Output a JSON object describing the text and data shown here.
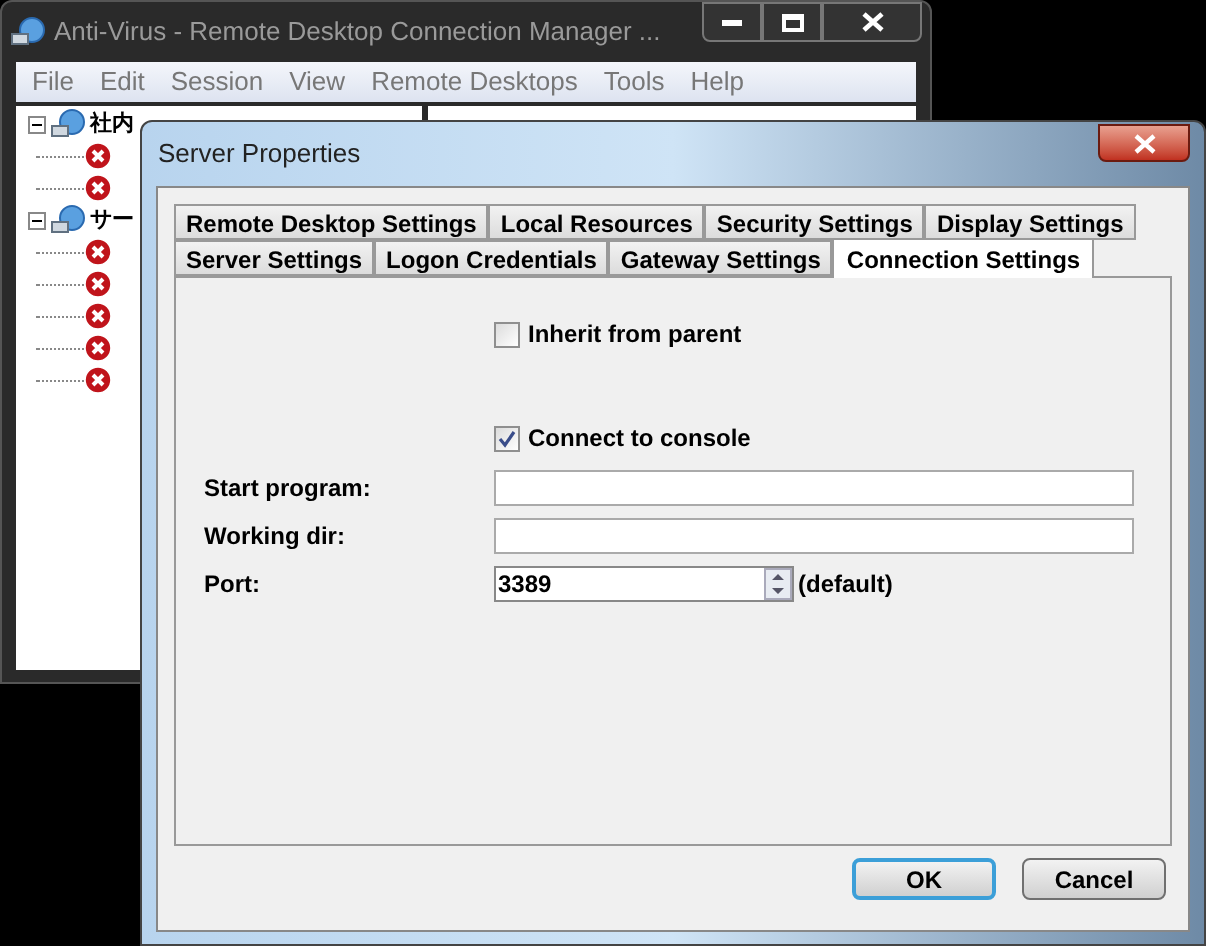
{
  "main_window": {
    "title": "Anti-Virus - Remote Desktop Connection Manager ...",
    "menu": [
      "File",
      "Edit",
      "Session",
      "View",
      "Remote Desktops",
      "Tools",
      "Help"
    ],
    "tree": [
      {
        "label": "社内",
        "expanded": true,
        "children": [
          {
            "kind": "error"
          },
          {
            "kind": "error"
          }
        ]
      },
      {
        "label": "サー",
        "expanded": true,
        "children": [
          {
            "kind": "error"
          },
          {
            "kind": "error"
          },
          {
            "kind": "error"
          },
          {
            "kind": "error"
          },
          {
            "kind": "error"
          }
        ]
      }
    ]
  },
  "dialog": {
    "title": "Server Properties",
    "tab_rows": [
      [
        {
          "label": "Remote Desktop Settings",
          "selected": false
        },
        {
          "label": "Local Resources",
          "selected": false
        },
        {
          "label": "Security Settings",
          "selected": false
        },
        {
          "label": "Display Settings",
          "selected": false
        }
      ],
      [
        {
          "label": "Server Settings",
          "selected": false
        },
        {
          "label": "Logon Credentials",
          "selected": false
        },
        {
          "label": "Gateway Settings",
          "selected": false
        },
        {
          "label": "Connection Settings",
          "selected": true
        }
      ]
    ],
    "inherit": {
      "label": "Inherit from parent",
      "checked": false
    },
    "console": {
      "label": "Connect to console",
      "checked": true
    },
    "fields": [
      {
        "label": "Start program:"
      },
      {
        "label": "Working dir:"
      }
    ],
    "port": {
      "label": "Port:",
      "value": "3389",
      "note": "(default)"
    },
    "buttons": [
      {
        "label": "OK",
        "default": true
      },
      {
        "label": "Cancel",
        "default": false
      }
    ]
  }
}
